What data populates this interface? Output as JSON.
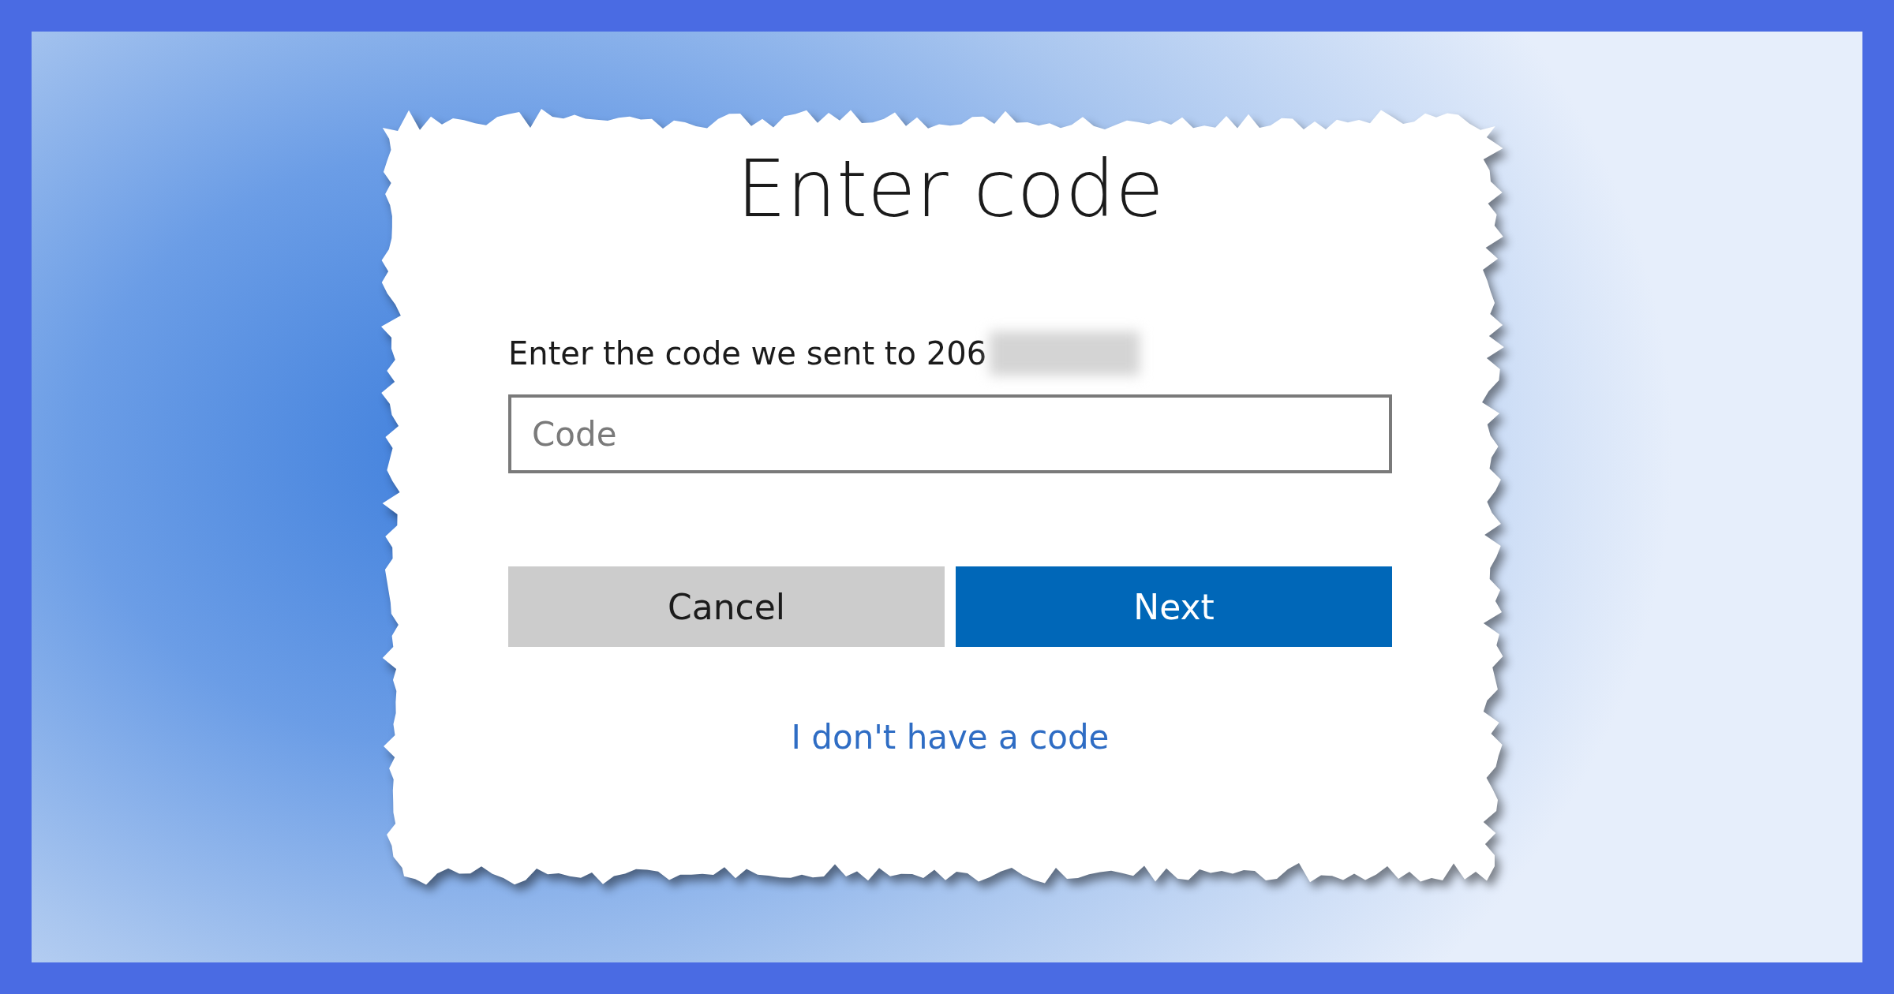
{
  "dialog": {
    "title": "Enter code",
    "message": "Enter the code we sent to 206",
    "message_redacted": true,
    "code_field": {
      "placeholder": "Code"
    },
    "buttons": [
      {
        "label": "Cancel",
        "kind": "secondary"
      },
      {
        "label": "Next",
        "kind": "primary"
      }
    ],
    "link": "I don't have a code"
  }
}
